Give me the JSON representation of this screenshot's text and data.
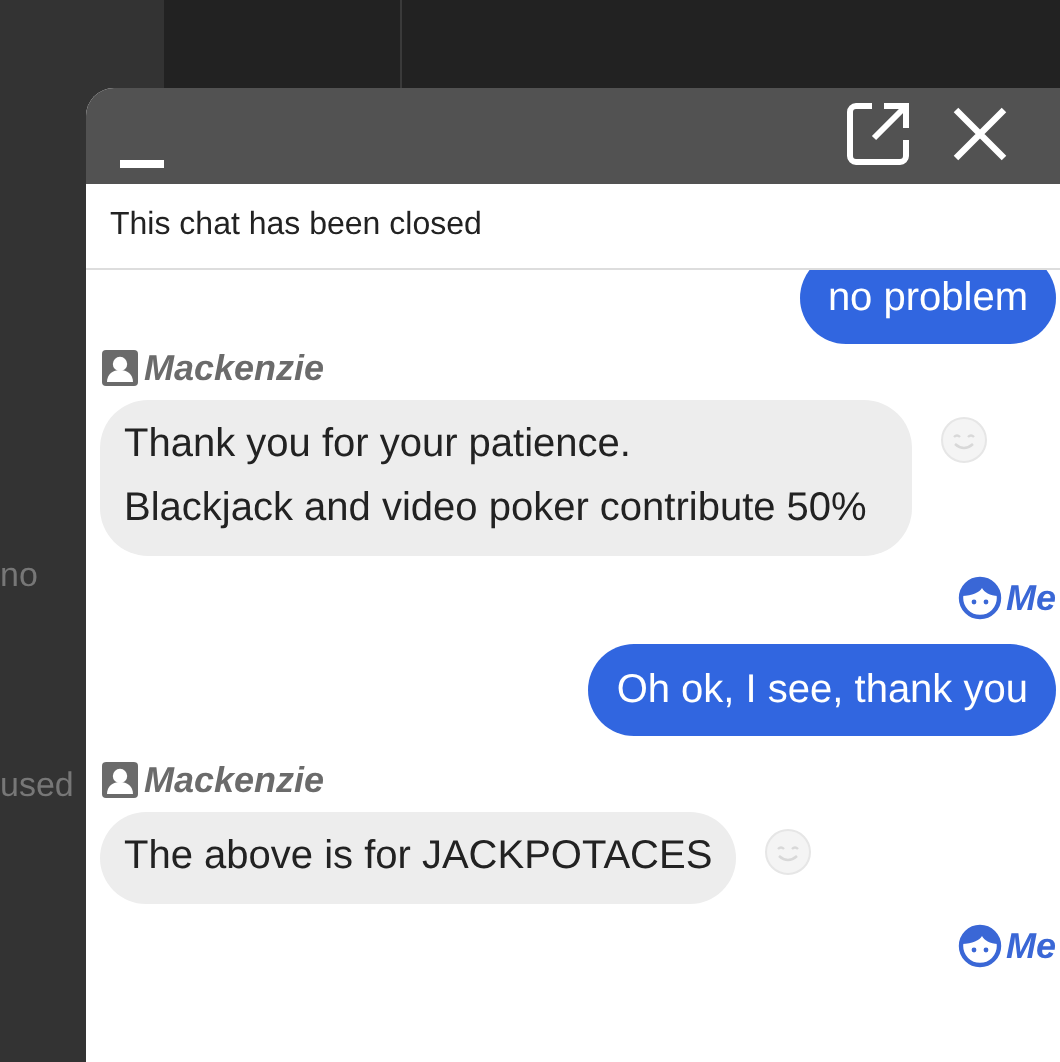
{
  "background": {
    "texts": [
      "no",
      "used"
    ]
  },
  "chat_window": {
    "status_banner": "This chat has been closed",
    "messages": [
      {
        "kind": "me",
        "text": "no problem"
      },
      {
        "kind": "sender",
        "name": "Mackenzie"
      },
      {
        "kind": "agent",
        "text": "Thank you for your patience.\nBlackjack and video poker contribute 50%"
      },
      {
        "kind": "me-label",
        "name": "Me"
      },
      {
        "kind": "me",
        "text": "Oh ok, I see, thank you"
      },
      {
        "kind": "sender",
        "name": "Mackenzie"
      },
      {
        "kind": "agent",
        "text": "The above is for JACKPOTACES"
      },
      {
        "kind": "me-label",
        "name": "Me"
      }
    ]
  }
}
